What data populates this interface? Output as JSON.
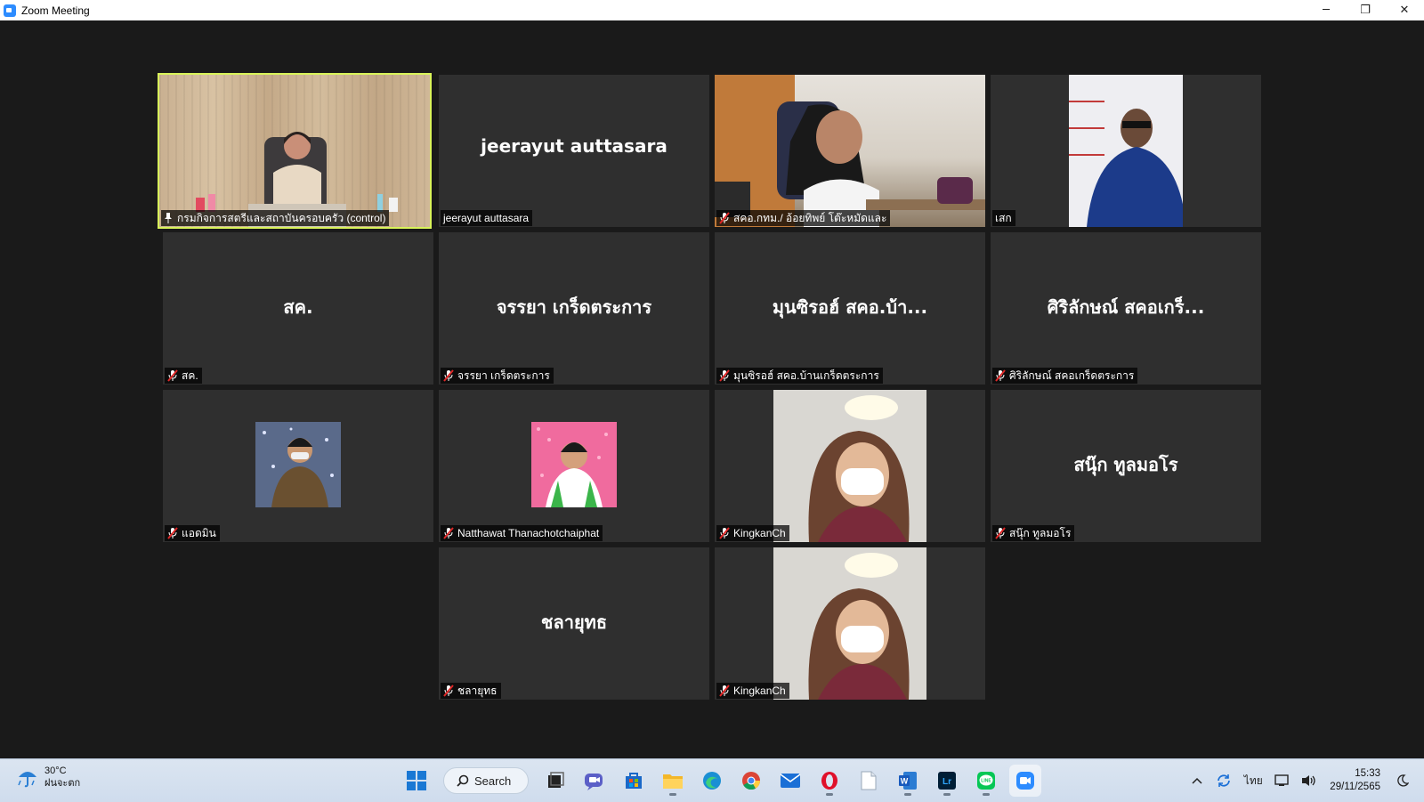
{
  "window": {
    "title": "Zoom Meeting",
    "minimize": "─",
    "restore": "❐",
    "close": "✕"
  },
  "participants": [
    {
      "display": "",
      "label": "กรมกิจการสตรีและสถาบันครอบครัว  (control)",
      "mic": "pinned",
      "active": true,
      "video": "room"
    },
    {
      "display": "jeerayut auttasara",
      "label": "jeerayut auttasara",
      "mic": "on",
      "video": "none"
    },
    {
      "display": "",
      "label": "สคอ.กทม./ อ้อยทิพย์ โต๊ะหมัดและ",
      "mic": "muted",
      "video": "office"
    },
    {
      "display": "",
      "label": "เสก",
      "mic": "none",
      "video": "office2"
    },
    {
      "display": "สค.",
      "label": "สค.",
      "mic": "muted",
      "video": "none"
    },
    {
      "display": "จรรยา เกร็ดตระการ",
      "label": "จรรยา เกร็ดตระการ",
      "mic": "muted",
      "video": "none"
    },
    {
      "display": "มุนซิรอฮ์ สคอ.บ้า...",
      "label": "มุนซิรอฮ์ สคอ.บ้านเกร็ดตระการ",
      "mic": "muted",
      "video": "none"
    },
    {
      "display": "ศิริลักษณ์ สคอเกร็...",
      "label": "ศิริลักษณ์ สคอเกร็ดตระการ",
      "mic": "muted",
      "video": "none"
    },
    {
      "display": "",
      "label": "แอดมิน",
      "mic": "muted",
      "video": "avatar1"
    },
    {
      "display": "",
      "label": "Natthawat Thanachotchaiphat",
      "mic": "muted",
      "video": "avatar2"
    },
    {
      "display": "",
      "label": "KingkanCh",
      "mic": "muted",
      "video": "selfie"
    },
    {
      "display": "สนุ๊ก ทูลมอโร",
      "label": "สนุ๊ก ทูลมอโร",
      "mic": "muted",
      "video": "none"
    },
    {
      "display": "ชลายุทธ",
      "label": "ชลายุทธ",
      "mic": "muted",
      "video": "none"
    },
    {
      "display": "",
      "label": "KingkanCh",
      "mic": "muted",
      "video": "selfie"
    }
  ],
  "taskbar": {
    "weather": {
      "temp": "30°C",
      "condition": "ฝนจะตก"
    },
    "search_label": "Search",
    "apps": [
      "start-icon",
      "search",
      "task-view-icon",
      "teams-chat-icon",
      "store-icon",
      "file-explorer-icon",
      "edge-icon",
      "chrome-icon",
      "mail-icon",
      "opera-icon",
      "notepad-icon",
      "word-icon",
      "lightroom-icon",
      "line-icon",
      "zoom-icon"
    ],
    "language": "ไทย",
    "time": "15:33",
    "date": "29/11/2565"
  },
  "colors": {
    "active_speaker": "#d9f35a",
    "tile_bg": "#2f2f2f",
    "muted_red": "#e02828",
    "zoom_blue": "#2d8cff"
  }
}
